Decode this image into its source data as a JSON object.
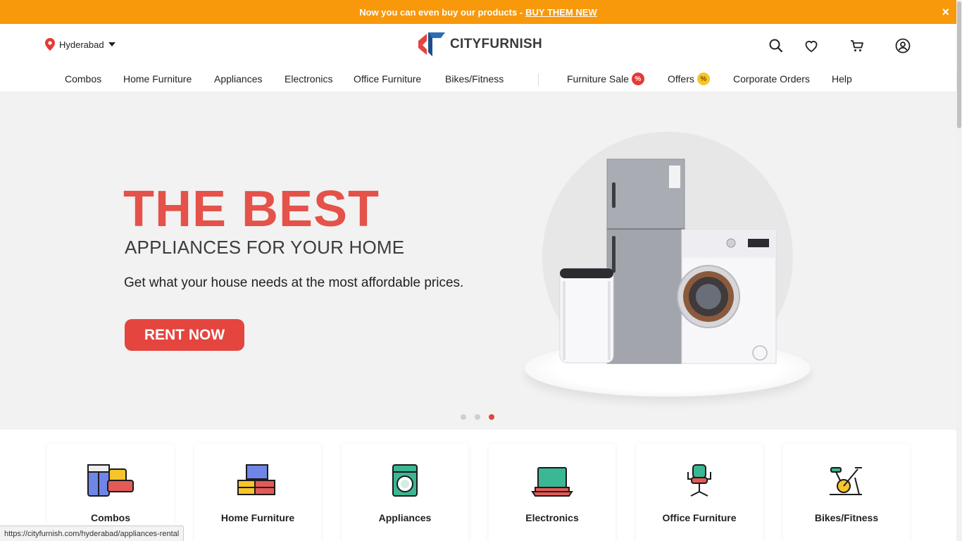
{
  "announcement": {
    "text": "Now you can even buy our products -",
    "link": "BUY THEM NEW",
    "close": "×"
  },
  "header": {
    "location": "Hyderabad",
    "brand": "CITYFURNISH",
    "icons": [
      "search-icon",
      "heart-icon",
      "cart-icon",
      "user-icon"
    ]
  },
  "nav": {
    "items": [
      "Combos",
      "Home Furniture",
      "Appliances",
      "Electronics",
      "Office Furniture",
      "Bikes/Fitness"
    ],
    "right_items": [
      "Furniture Sale",
      "Offers",
      "Corporate Orders",
      "Help"
    ],
    "sale_badge": "%",
    "offers_badge": "%"
  },
  "hero": {
    "headline": "THE BEST",
    "subheadline": "APPLIANCES FOR YOUR HOME",
    "description": "Get what your house needs at the most affordable prices.",
    "cta": "RENT NOW",
    "slide_count": 3,
    "active_slide": 3
  },
  "categories": [
    {
      "label": "Combos",
      "icon": "sofa-wardrobe-icon"
    },
    {
      "label": "Home Furniture",
      "icon": "furniture-icon"
    },
    {
      "label": "Appliances",
      "icon": "washing-machine-icon"
    },
    {
      "label": "Electronics",
      "icon": "laptop-icon"
    },
    {
      "label": "Office Furniture",
      "icon": "office-chair-icon"
    },
    {
      "label": "Bikes/Fitness",
      "icon": "exercise-bike-icon"
    }
  ],
  "status_url": "https://cityfurnish.com/hyderabad/appliances-rental",
  "colors": {
    "announcement_bg": "#F8980B",
    "brand_red": "#E4453E",
    "hero_bg": "#F2F2F2"
  }
}
